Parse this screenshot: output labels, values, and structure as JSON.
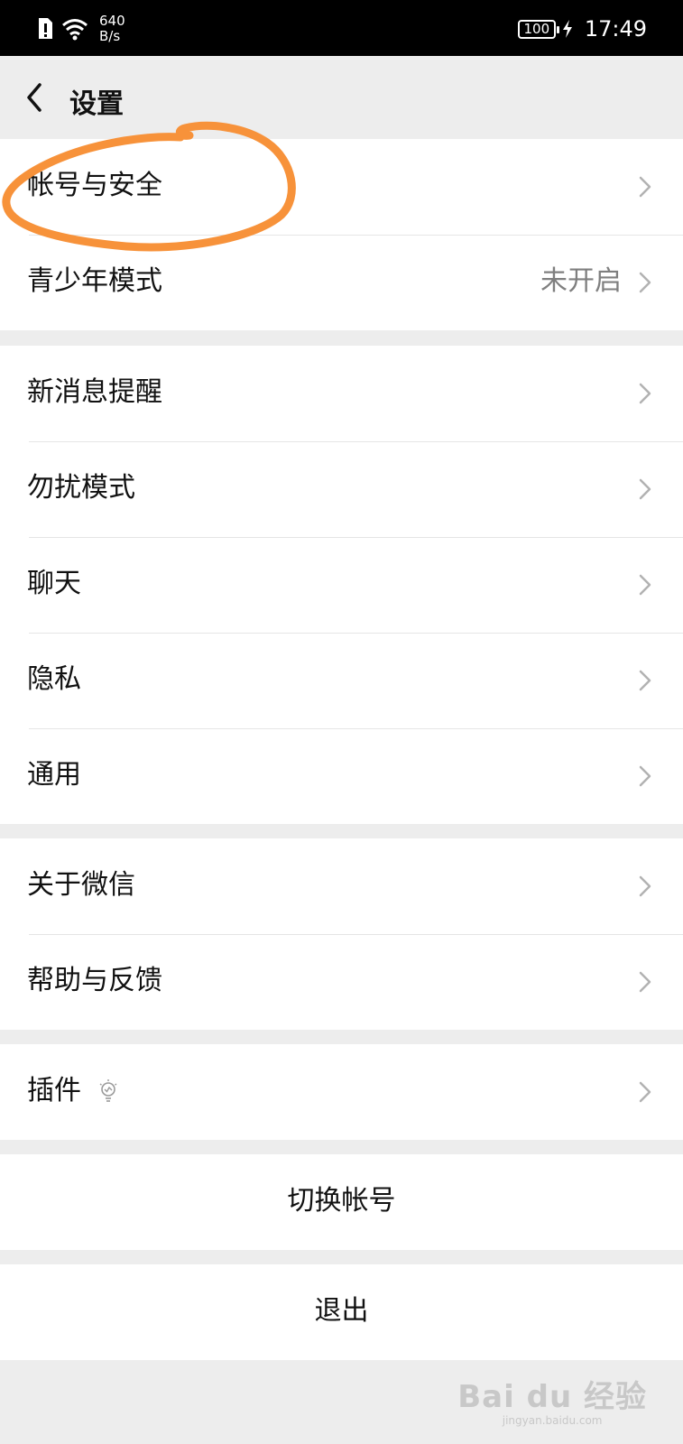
{
  "status_bar": {
    "net_speed_value": "640",
    "net_speed_unit": "B/s",
    "battery": "100",
    "time": "17:49",
    "icons": [
      "sim-alert-icon",
      "wifi-icon",
      "charging-icon"
    ]
  },
  "header": {
    "back_icon": "chevron-left-icon",
    "title": "设置"
  },
  "groups": {
    "account": [
      {
        "label": "帐号与安全",
        "value": ""
      },
      {
        "label": "青少年模式",
        "value": "未开启"
      }
    ],
    "general": [
      {
        "label": "新消息提醒"
      },
      {
        "label": "勿扰模式"
      },
      {
        "label": "聊天"
      },
      {
        "label": "隐私"
      },
      {
        "label": "通用"
      }
    ],
    "about": [
      {
        "label": "关于微信"
      },
      {
        "label": "帮助与反馈"
      }
    ],
    "plugins": [
      {
        "label": "插件",
        "icon": "lightbulb-icon"
      }
    ]
  },
  "actions": {
    "switch_account": "切换帐号",
    "logout": "退出"
  },
  "annotation": {
    "color": "#f7923a",
    "icon": "circle-highlight"
  },
  "watermark": {
    "main": "Bai du 经验",
    "sub": "jingyan.baidu.com"
  }
}
